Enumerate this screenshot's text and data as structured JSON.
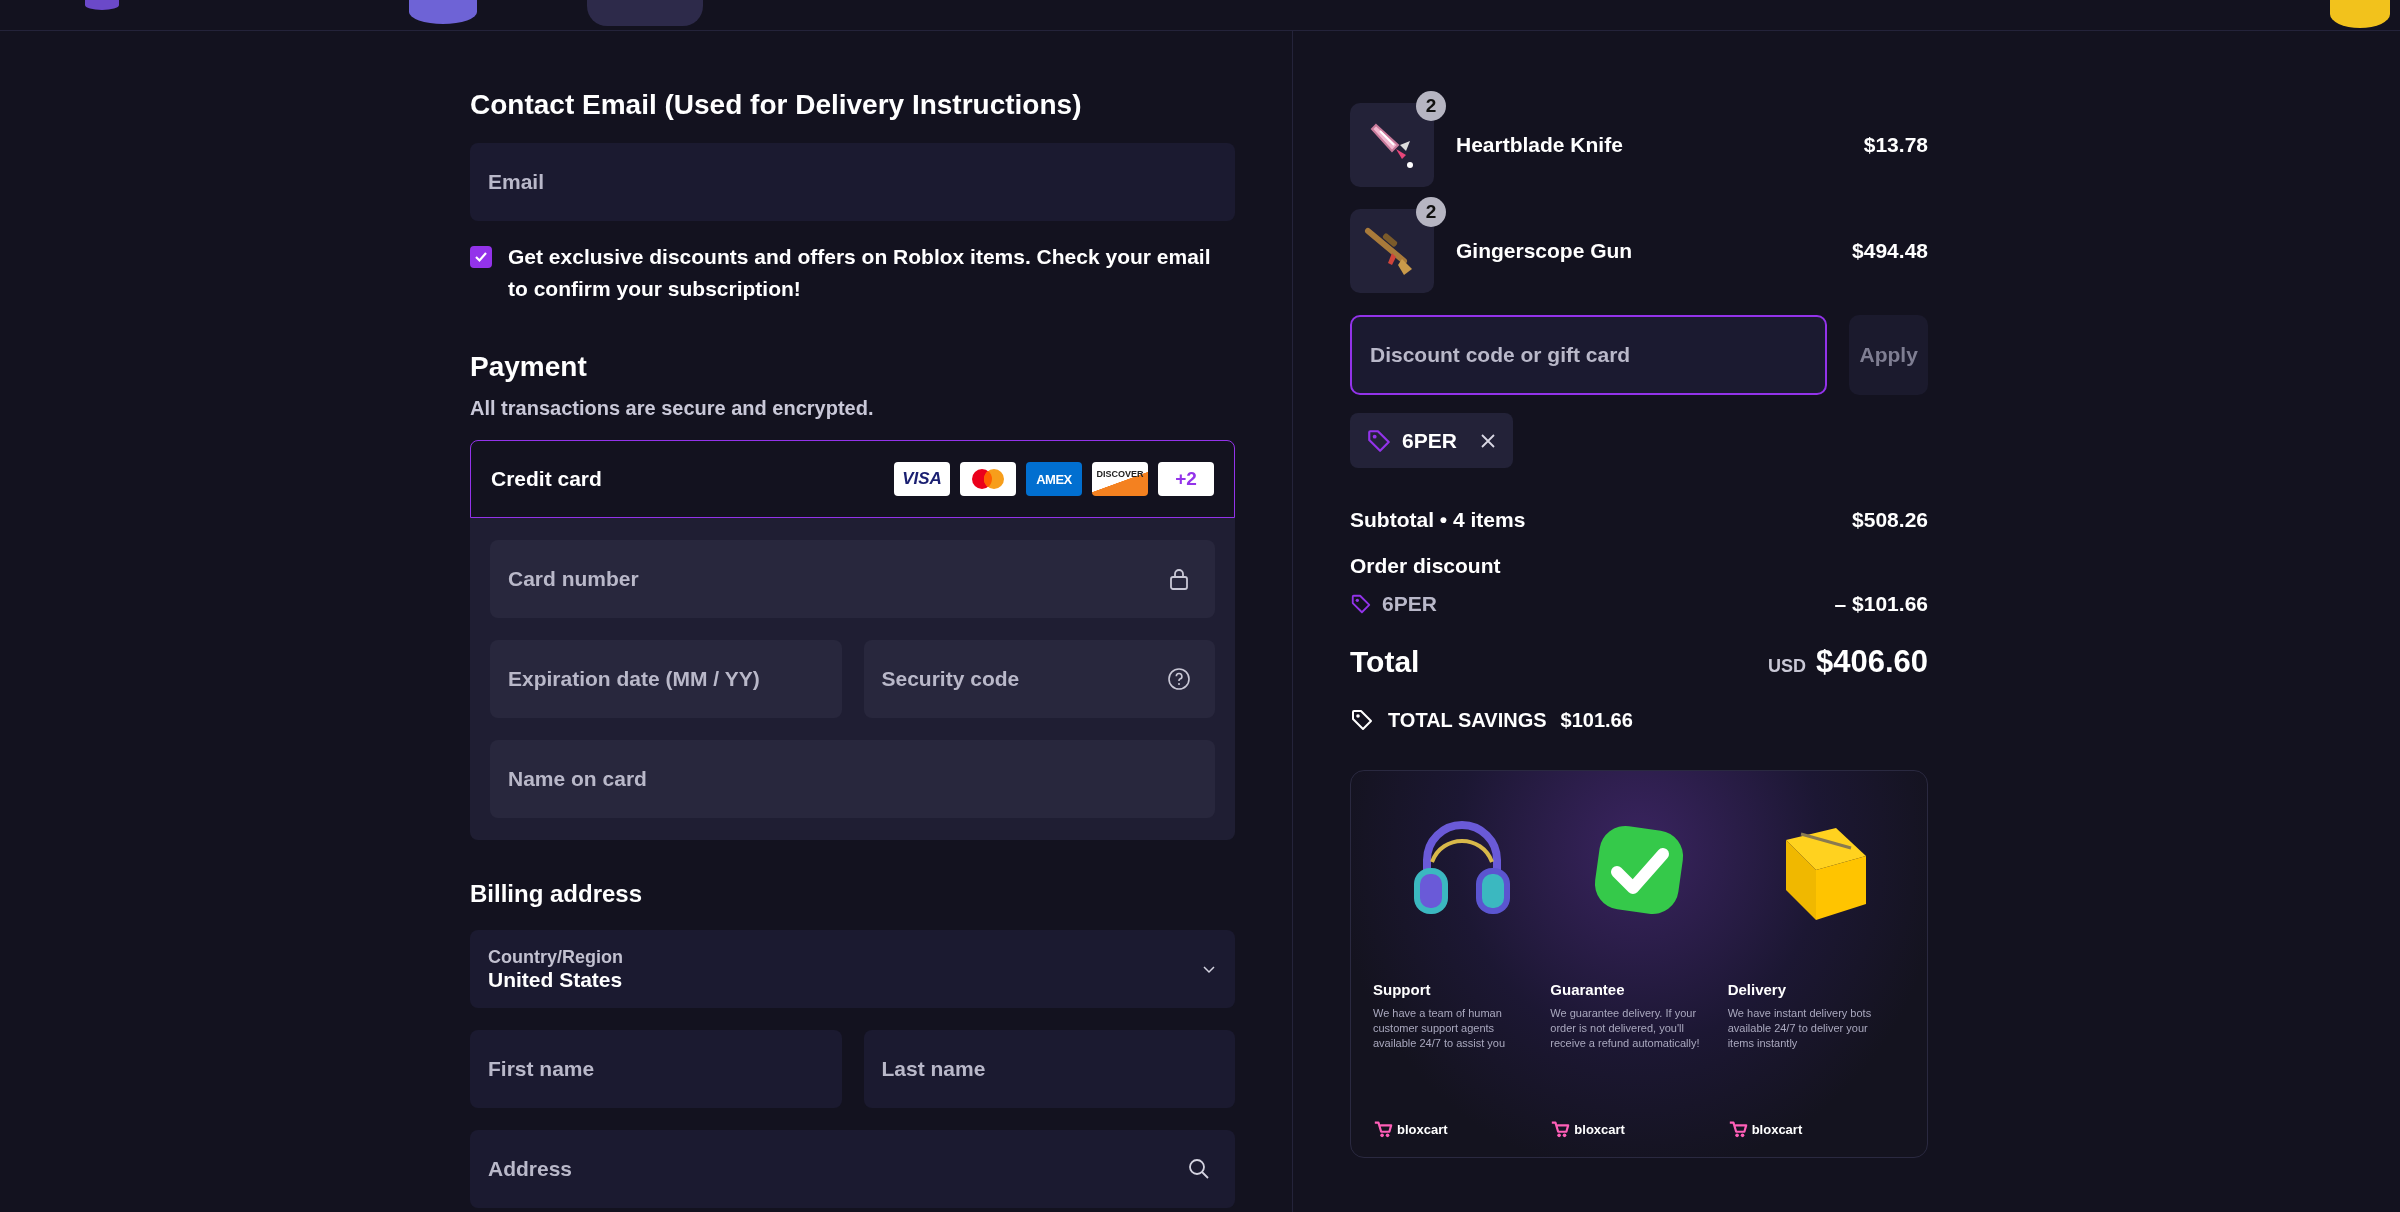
{
  "contact": {
    "title": "Contact Email (Used for Delivery Instructions)",
    "email": {
      "placeholder": "Email"
    },
    "newsletter": {
      "checked": true,
      "text": "Get exclusive discounts and offers on Roblox items. Check your email to confirm your subscription!"
    }
  },
  "payment": {
    "title": "Payment",
    "subtitle": "All transactions are secure and encrypted.",
    "method": {
      "label": "Credit card",
      "selected": true,
      "brands": [
        {
          "kind": "visa",
          "text": "VISA"
        },
        {
          "kind": "mastercard"
        },
        {
          "kind": "amex",
          "text": "AMEX"
        },
        {
          "kind": "discover",
          "text": "DISCOVER"
        },
        {
          "kind": "more",
          "text": "+2"
        }
      ]
    },
    "fields": [
      [
        {
          "placeholder": "Card number",
          "kind": "card_number"
        }
      ],
      [
        {
          "placeholder": "Expiration date (MM / YY)",
          "kind": "expiry"
        },
        {
          "placeholder": "Security code",
          "kind": "security_code"
        }
      ],
      [
        {
          "placeholder": "Name on card"
        }
      ]
    ]
  },
  "billing": {
    "title": "Billing address",
    "country": {
      "label": "Country/Region",
      "value": "United States"
    },
    "fields": [
      [
        {
          "placeholder": "First name"
        },
        {
          "placeholder": "Last name"
        }
      ],
      [
        {
          "placeholder": "Address",
          "kind": "address"
        }
      ]
    ]
  },
  "cart": {
    "items": [
      {
        "name": "Heartblade Knife",
        "quantity": "2",
        "price": "$13.78"
      },
      {
        "name": "Gingerscope Gun",
        "quantity": "2",
        "price": "$494.48"
      }
    ],
    "discount": {
      "placeholder": "Discount code or gift card",
      "focused": true,
      "button": "Apply"
    },
    "applied_codes": [
      {
        "code": "6PER"
      }
    ],
    "subtotal": {
      "label": "Subtotal • 4 items",
      "value": "$508.26"
    },
    "order_discount": {
      "label": "Order discount",
      "code": "6PER",
      "value": "– $101.66"
    },
    "total": {
      "label": "Total",
      "currency": "USD",
      "value": "$406.60"
    },
    "savings": {
      "label": "TOTAL SAVINGS",
      "value": "$101.66"
    }
  },
  "features": [
    {
      "title": "Support",
      "text": "We have a team of human customer support agents available 24/7 to assist you",
      "brand": "bloxcart"
    },
    {
      "title": "Guarantee",
      "text": "We guarantee delivery. If your order is not delivered, you'll receive a refund automatically!",
      "brand": "bloxcart"
    },
    {
      "title": "Delivery",
      "text": "We have instant delivery bots available 24/7 to deliver your items instantly",
      "brand": "bloxcart"
    }
  ]
}
